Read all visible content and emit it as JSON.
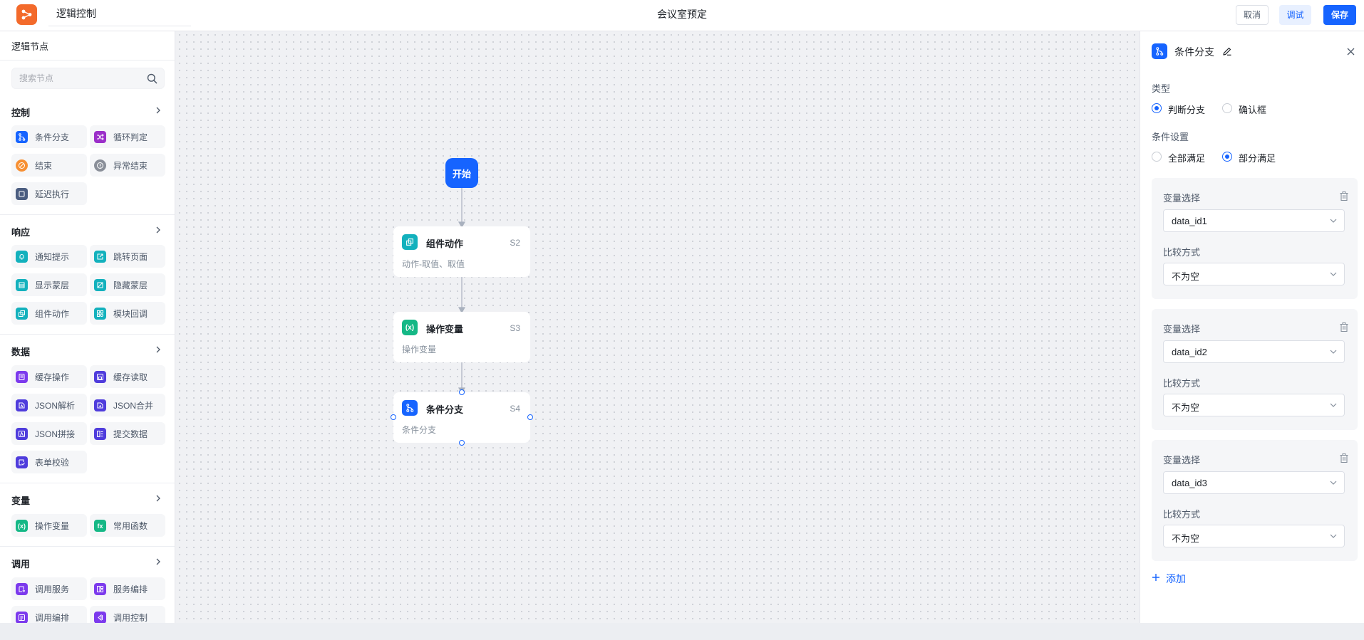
{
  "header": {
    "app_name": "逻辑控制",
    "page_title": "会议室预定",
    "cancel_label": "取消",
    "debug_label": "调试",
    "save_label": "保存"
  },
  "sidebar": {
    "title": "逻辑节点",
    "search_placeholder": "搜索节点",
    "sections": [
      {
        "title": "控制",
        "items": [
          {
            "label": "条件分支",
            "icon": "branch-icon"
          },
          {
            "label": "循环判定",
            "icon": "shuffle-icon"
          },
          {
            "label": "结束",
            "icon": "stop-icon"
          },
          {
            "label": "异常结束",
            "icon": "error-icon"
          },
          {
            "label": "延迟执行",
            "icon": "delay-icon"
          }
        ]
      },
      {
        "title": "响应",
        "items": [
          {
            "label": "通知提示",
            "icon": "bell-icon"
          },
          {
            "label": "跳转页面",
            "icon": "jump-icon"
          },
          {
            "label": "显示蒙层",
            "icon": "mask-show-icon"
          },
          {
            "label": "隐藏蒙层",
            "icon": "mask-hide-icon"
          },
          {
            "label": "组件动作",
            "icon": "component-icon"
          },
          {
            "label": "模块回调",
            "icon": "module-icon"
          }
        ]
      },
      {
        "title": "数据",
        "items": [
          {
            "label": "缓存操作",
            "icon": "cache-icon"
          },
          {
            "label": "缓存读取",
            "icon": "cache-read-icon"
          },
          {
            "label": "JSON解析",
            "icon": "json-parse-icon"
          },
          {
            "label": "JSON合并",
            "icon": "json-merge-icon"
          },
          {
            "label": "JSON拼接",
            "icon": "json-concat-icon"
          },
          {
            "label": "提交数据",
            "icon": "submit-icon"
          },
          {
            "label": "表单校验",
            "icon": "validate-icon"
          }
        ]
      },
      {
        "title": "变量",
        "items": [
          {
            "label": "操作变量",
            "icon": "variable-icon"
          },
          {
            "label": "常用函数",
            "icon": "function-icon"
          }
        ]
      },
      {
        "title": "调用",
        "items": [
          {
            "label": "调用服务",
            "icon": "service-icon"
          },
          {
            "label": "服务编排",
            "icon": "orchestrate-icon"
          },
          {
            "label": "调用编排",
            "icon": "call-orchestrate-icon"
          },
          {
            "label": "调用控制",
            "icon": "call-control-icon"
          }
        ]
      }
    ]
  },
  "flow": {
    "start_label": "开始",
    "nodes": [
      {
        "title": "组件动作",
        "step": "S2",
        "desc": "动作-取值、取值",
        "icon": "component-icon"
      },
      {
        "title": "操作变量",
        "step": "S3",
        "desc": "操作变量",
        "icon": "variable-icon"
      },
      {
        "title": "条件分支",
        "step": "S4",
        "desc": "条件分支",
        "icon": "branch-icon"
      }
    ]
  },
  "panel": {
    "title": "条件分支",
    "type_label": "类型",
    "type_options": [
      "判断分支",
      "确认框"
    ],
    "type_selected": "判断分支",
    "condition_label": "条件设置",
    "condition_options": [
      "全部满足",
      "部分满足"
    ],
    "condition_selected": "部分满足",
    "variable_label": "变量选择",
    "compare_label": "比较方式",
    "conditions": [
      {
        "variable": "data_id1",
        "compare": "不为空"
      },
      {
        "variable": "data_id2",
        "compare": "不为空"
      },
      {
        "variable": "data_id3",
        "compare": "不为空"
      }
    ],
    "add_label": "添加"
  },
  "colors": {
    "primary": "#1664ff",
    "logo": "#f36a2b",
    "canvas_bg": "#f0f1f4"
  }
}
